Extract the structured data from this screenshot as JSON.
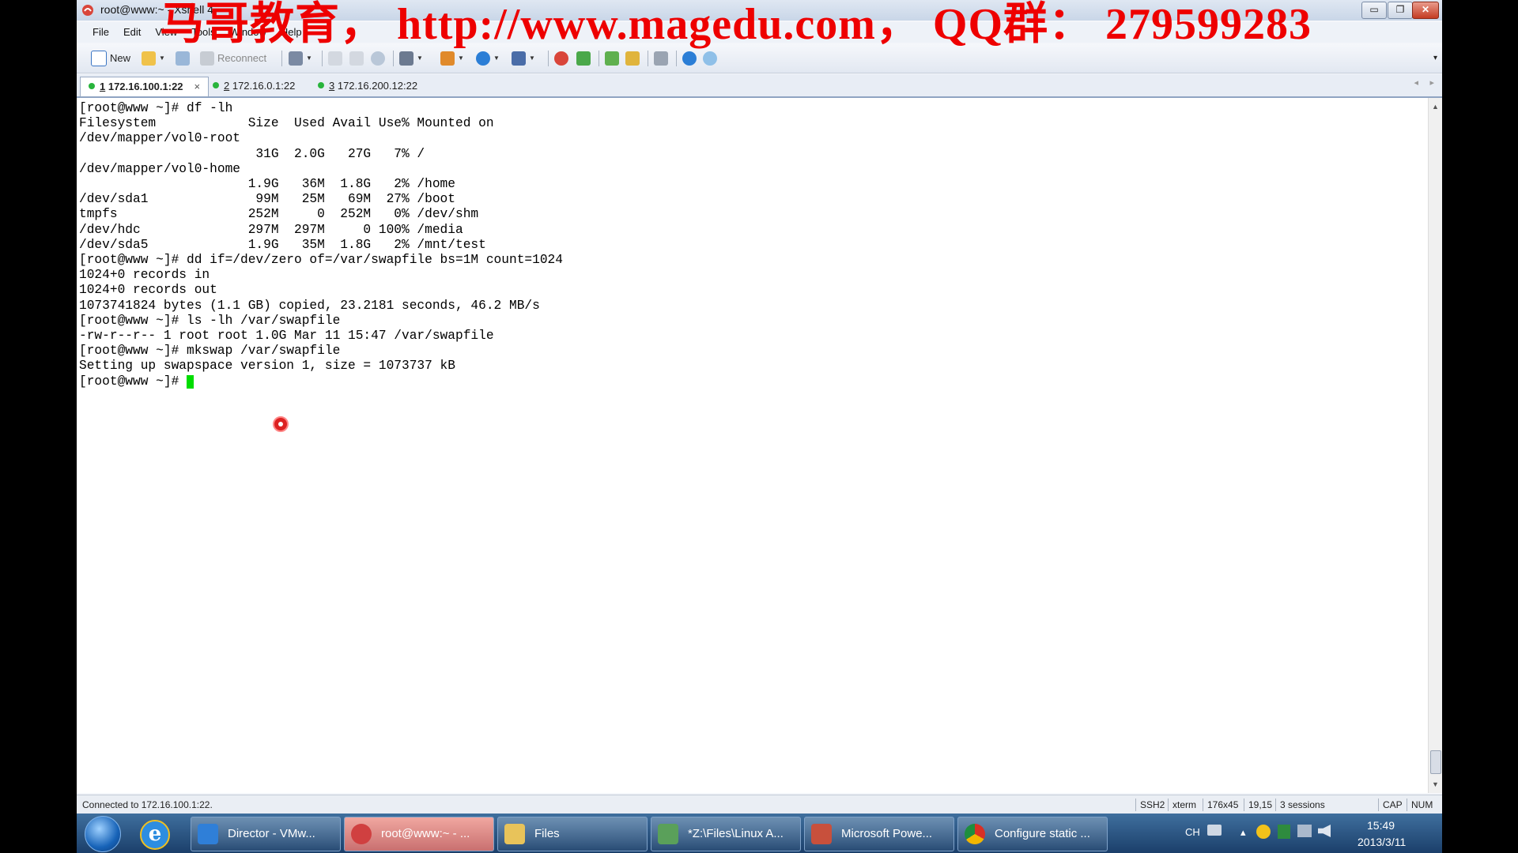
{
  "window": {
    "title": "root@www:~ - Xshell 4",
    "min_glyph": "▭",
    "max_glyph": "❐",
    "close_glyph": "✕"
  },
  "watermark": "马哥教育， http://www.magedu.com， QQ群： 279599283",
  "menu": [
    "File",
    "Edit",
    "View",
    "Tools",
    "Window",
    "Help"
  ],
  "toolbar": {
    "new_label": "New",
    "reconnect_label": "Reconnect",
    "overflow_glyph": "▾"
  },
  "tabs": [
    {
      "num": "1",
      "label": " 172.16.100.1:22",
      "close": "×"
    },
    {
      "num": "2",
      "label": " 172.16.0.1:22"
    },
    {
      "num": "3",
      "label": " 172.16.200.12:22"
    }
  ],
  "tab_nav": {
    "prev": "◂",
    "next": "▸"
  },
  "terminal": {
    "lines": [
      "[root@www ~]# df -lh",
      "Filesystem            Size  Used Avail Use% Mounted on",
      "/dev/mapper/vol0-root",
      "                       31G  2.0G   27G   7% /",
      "/dev/mapper/vol0-home",
      "                      1.9G   36M  1.8G   2% /home",
      "/dev/sda1              99M   25M   69M  27% /boot",
      "tmpfs                 252M     0  252M   0% /dev/shm",
      "/dev/hdc              297M  297M     0 100% /media",
      "/dev/sda5             1.9G   35M  1.8G   2% /mnt/test",
      "[root@www ~]# dd if=/dev/zero of=/var/swapfile bs=1M count=1024",
      "1024+0 records in",
      "1024+0 records out",
      "1073741824 bytes (1.1 GB) copied, 23.2181 seconds, 46.2 MB/s",
      "[root@www ~]# ls -lh /var/swapfile",
      "-rw-r--r-- 1 root root 1.0G Mar 11 15:47 /var/swapfile",
      "[root@www ~]# mkswap /var/swapfile",
      "Setting up swapspace version 1, size = 1073737 kB",
      "[root@www ~]# "
    ]
  },
  "scroll": {
    "up": "▲",
    "down": "▼"
  },
  "status": {
    "connection": "Connected to 172.16.100.1:22.",
    "protocol": "SSH2",
    "term_type": "xterm",
    "size": "176x45",
    "cursor_pos": "19,15",
    "sessions": "3 sessions",
    "cap": "CAP",
    "num": "NUM"
  },
  "taskbar": {
    "ie_glyph": "e",
    "items": [
      {
        "label": "Director - VMw...",
        "color": "#2f7fd8"
      },
      {
        "label": "root@www:~ - ...",
        "color": "#d04040"
      },
      {
        "label": "Files",
        "color": "#e8c35a"
      },
      {
        "label": "*Z:\\Files\\Linux A...",
        "color": "#5aa05a"
      },
      {
        "label": "Microsoft Powe...",
        "color": "#c8503c"
      },
      {
        "label": "Configure static ...",
        "color": "#3a9a4a"
      }
    ],
    "tray": {
      "lang": "CH",
      "arrow": "▴",
      "time": "15:49",
      "date": "2013/3/11"
    }
  }
}
